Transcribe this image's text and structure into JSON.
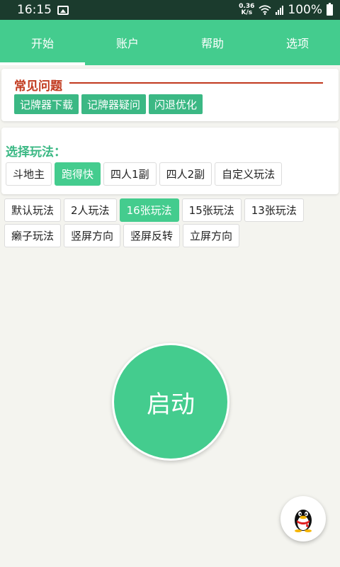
{
  "status_bar": {
    "time": "16:15",
    "net_speed_value": "0.36",
    "net_speed_unit": "K/s",
    "battery": "100%"
  },
  "tabs": [
    {
      "label": "开始"
    },
    {
      "label": "账户"
    },
    {
      "label": "帮助"
    },
    {
      "label": "选项"
    }
  ],
  "faq": {
    "title": "常见问题",
    "buttons": [
      "记牌器下载",
      "记牌器疑问",
      "闪退优化"
    ]
  },
  "mode": {
    "title": "选择玩法：",
    "options": [
      "斗地主",
      "跑得快",
      "四人1副",
      "四人2副",
      "自定义玩法"
    ],
    "selected": "跑得快"
  },
  "sub_options": {
    "row1": [
      "默认玩法",
      "2人玩法",
      "16张玩法",
      "15张玩法",
      "13张玩法"
    ],
    "row2": [
      "癞子玩法",
      "竖屏方向",
      "竖屏反转",
      "立屏方向"
    ],
    "selected": "16张玩法"
  },
  "start_button": {
    "label": "启动"
  },
  "colors": {
    "primary": "#44cc8e",
    "status_bar": "#1b3b2d",
    "faq_accent": "#c1391e",
    "background": "#f4f4ef"
  },
  "icons": {
    "gallery": "image-icon",
    "wifi": "wifi-icon",
    "signal": "signal-icon",
    "battery": "battery-icon",
    "fab": "qq-penguin-icon"
  }
}
